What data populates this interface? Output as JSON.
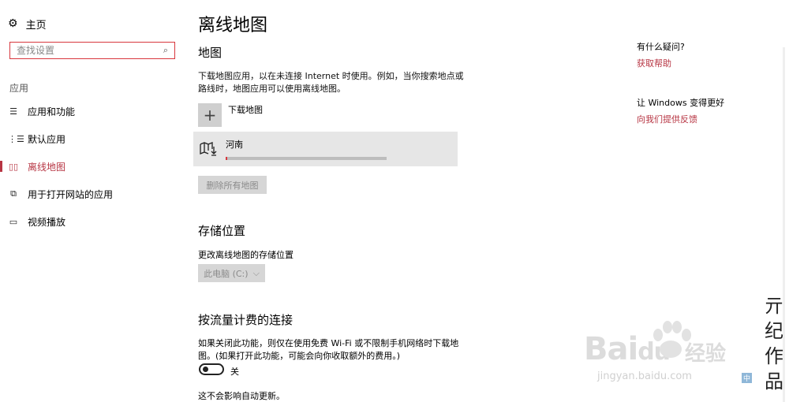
{
  "sidebar": {
    "home_label": "主页",
    "search_placeholder": "查找设置",
    "section_label": "应用",
    "items": [
      {
        "label": "应用和功能",
        "icon": "apps-features-icon"
      },
      {
        "label": "默认应用",
        "icon": "default-apps-icon"
      },
      {
        "label": "离线地图",
        "icon": "offline-maps-icon",
        "active": true
      },
      {
        "label": "用于打开网站的应用",
        "icon": "apps-for-websites-icon"
      },
      {
        "label": "视频播放",
        "icon": "video-playback-icon"
      }
    ]
  },
  "main": {
    "title": "离线地图",
    "maps": {
      "heading": "地图",
      "description": "下载地图应用，以在未连接 Internet 时使用。例如，当你搜索地点或路线时，地图应用可以使用离线地图。",
      "download_label": "下载地图",
      "downloading_item": {
        "name": "河南",
        "progress_fraction": 0.01
      },
      "delete_all_label": "删除所有地图"
    },
    "storage": {
      "heading": "存储位置",
      "description": "更改离线地图的存储位置",
      "selected_drive": "此电脑 (C:)"
    },
    "metered": {
      "heading": "按流量计费的连接",
      "description": "如果关闭此功能，则仅在使用免费 Wi-Fi 或不限制手机网络时下载地图。(如果打开此功能，可能会向你收取额外的费用。)",
      "toggle_state_label": "关",
      "note": "这不会影响自动更新。"
    }
  },
  "right_panel": {
    "question": "有什么疑问?",
    "help_link": "获取帮助",
    "improve": "让 Windows 变得更好",
    "feedback_link": "向我们提供反馈"
  },
  "watermark": {
    "brand": "Bai",
    "brand_suffix": "经验",
    "url": "jingyan.baidu.com",
    "calligraphy": "亓纪作品",
    "stamp": "中"
  },
  "colors": {
    "accent": "#b73543",
    "search_border": "#d8373d"
  }
}
